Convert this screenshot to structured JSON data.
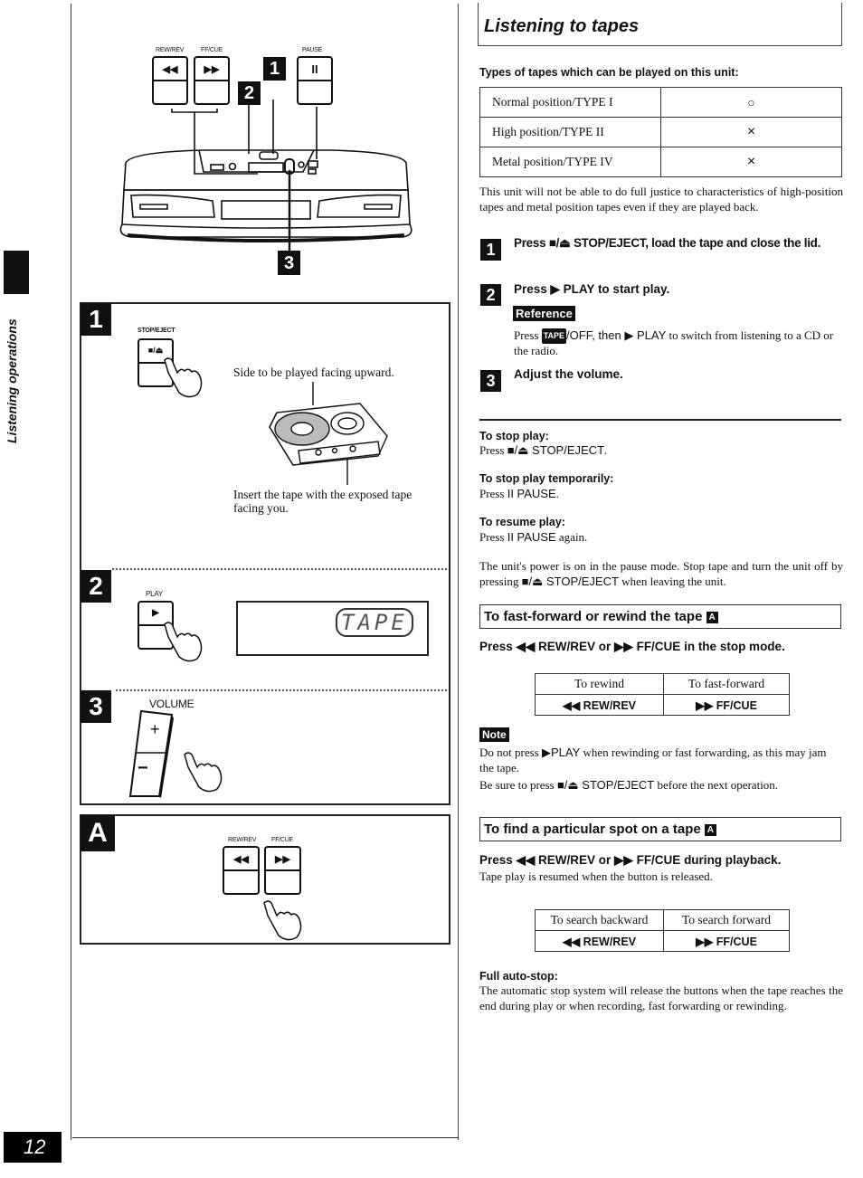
{
  "side_tab": {
    "label": "Listening operations"
  },
  "page_number": "12",
  "overview_figure": {
    "keys": [
      {
        "label": "REW/REV",
        "glyph": "◀◀"
      },
      {
        "label": "FF/CUE",
        "glyph": "▶▶"
      },
      {
        "label": "PAUSE",
        "glyph": "II"
      }
    ],
    "callouts": [
      "1",
      "2",
      "3"
    ]
  },
  "panel_1": {
    "badge": "1",
    "key_label": "STOP/EJECT",
    "key_glyph": "■/⏏",
    "caption_top": "Side to be played facing upward.",
    "caption_bottom": "Insert the tape with the exposed tape facing you."
  },
  "panel_2": {
    "badge": "2",
    "key_label": "PLAY",
    "key_glyph": "▶",
    "display_text": "TAPE"
  },
  "panel_3": {
    "badge": "3",
    "key_label": "VOLUME",
    "plus": "+",
    "minus": "−"
  },
  "panel_a": {
    "badge": "A",
    "keys": [
      {
        "label": "REW/REV",
        "glyph": "◀◀"
      },
      {
        "label": "FF/CUE",
        "glyph": "▶▶"
      }
    ]
  },
  "main": {
    "title": "Listening to tapes",
    "tape_types_heading": "Types of tapes which can be played on this unit:",
    "tape_types": [
      {
        "type": "Normal position/TYPE I",
        "playable": "○"
      },
      {
        "type": "High position/TYPE II",
        "playable": "×"
      },
      {
        "type": "Metal position/TYPE IV",
        "playable": "×"
      }
    ],
    "tape_types_note": "This unit will not be able to do full justice to characteristics of high-position tapes and metal position tapes even if they are played back.",
    "steps": [
      {
        "num": "1",
        "text": "Press ■/⏏ STOP/EJECT, load the tape and close the lid."
      },
      {
        "num": "2",
        "text": "Press ▶ PLAY to start play."
      },
      {
        "num": "3",
        "text": "Adjust the volume."
      }
    ],
    "reference": {
      "tag": "Reference",
      "pre": "Press ",
      "tape_tag": "TAPE",
      "mid": "/OFF, then ",
      "play_sym": "▶ PLAY",
      "post": " to switch from listening to a CD or the radio."
    },
    "tips": [
      {
        "heading": "To stop play:",
        "pre": "Press ",
        "key": "■/⏏ STOP/EJECT",
        "post": "."
      },
      {
        "heading": "To stop play temporarily:",
        "pre": "Press ",
        "key": "II PAUSE",
        "post": "."
      },
      {
        "heading": "To resume play:",
        "pre": "Press ",
        "key": "II PAUSE",
        "post": " again."
      }
    ],
    "pause_note": {
      "pre": "The unit's power is on in the pause mode. Stop tape and turn the unit off by pressing ",
      "key": "■/⏏ STOP/EJECT",
      "post": " when leaving the unit."
    },
    "ff_rew": {
      "heading": "To fast-forward or rewind the tape",
      "heading_tag": "A",
      "instruction": "Press ◀◀ REW/REV or ▶▶ FF/CUE in the stop mode.",
      "table": {
        "headers": [
          "To rewind",
          "To fast-forward"
        ],
        "values": [
          "◀◀ REW/REV",
          "▶▶ FF/CUE"
        ]
      },
      "note_tag": "Note",
      "note_1_pre": "Do not press ",
      "note_1_key": "▶PLAY",
      "note_1_post": " when rewinding or fast forwarding, as this may jam the tape.",
      "note_2_pre": "Be sure to press ",
      "note_2_key": "■/⏏ STOP/EJECT",
      "note_2_post": " before the next operation."
    },
    "find_spot": {
      "heading": "To find a particular spot on a tape",
      "heading_tag": "A",
      "instruction": "Press ◀◀ REW/REV or ▶▶ FF/CUE during playback.",
      "sub": "Tape play is resumed when the button is released.",
      "table": {
        "headers": [
          "To search backward",
          "To search forward"
        ],
        "values": [
          "◀◀ REW/REV",
          "▶▶ FF/CUE"
        ]
      }
    },
    "auto_stop": {
      "heading": "Full auto-stop:",
      "text": "The automatic stop system will release the buttons when the tape reaches the end during play or when recording, fast forwarding or rewinding."
    }
  }
}
